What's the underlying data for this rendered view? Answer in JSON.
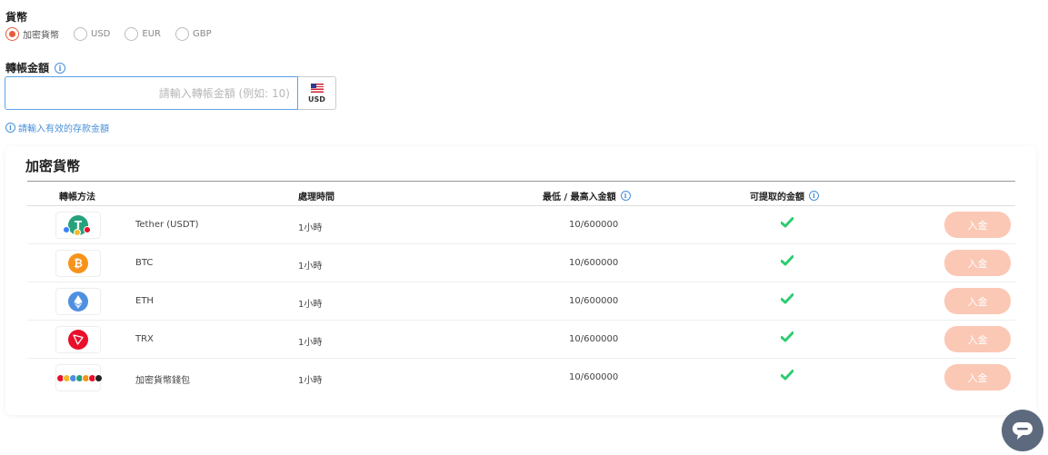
{
  "currency": {
    "label": "貨幣",
    "options": [
      {
        "label": "加密貨幣",
        "checked": true
      },
      {
        "label": "USD",
        "checked": false
      },
      {
        "label": "EUR",
        "checked": false
      },
      {
        "label": "GBP",
        "checked": false
      }
    ]
  },
  "amount": {
    "label": "轉帳金額",
    "placeholder": "請輸入轉帳金額 (例如: 10)",
    "currency_badge": "USD",
    "hint": "請輸入有效的存款金額"
  },
  "crypto_section": {
    "title": "加密貨幣",
    "columns": {
      "method": "轉帳方法",
      "processing_time": "處理時間",
      "min_max": "最低 / 最高入金額",
      "withdrawable": "可提取的金額"
    },
    "rows": [
      {
        "name": "Tether (USDT)",
        "time": "1小時",
        "range": "10/600000",
        "icon": "usdt-icon",
        "button": "入金"
      },
      {
        "name": "BTC",
        "time": "1小時",
        "range": "10/600000",
        "icon": "btc-icon",
        "button": "入金"
      },
      {
        "name": "ETH",
        "time": "1小時",
        "range": "10/600000",
        "icon": "eth-icon",
        "button": "入金"
      },
      {
        "name": "TRX",
        "time": "1小時",
        "range": "10/600000",
        "icon": "trx-icon",
        "button": "入金"
      },
      {
        "name": "加密貨幣錢包",
        "time": "1小時",
        "range": "10/600000",
        "icon": "crypto-wallet-icon",
        "button": "入金"
      }
    ]
  },
  "colors": {
    "accent": "#e85a3c",
    "link": "#4a90d9",
    "check": "#2ecc71",
    "button_disabled": "#fbc8b5",
    "chat": "#5d6a7e"
  }
}
